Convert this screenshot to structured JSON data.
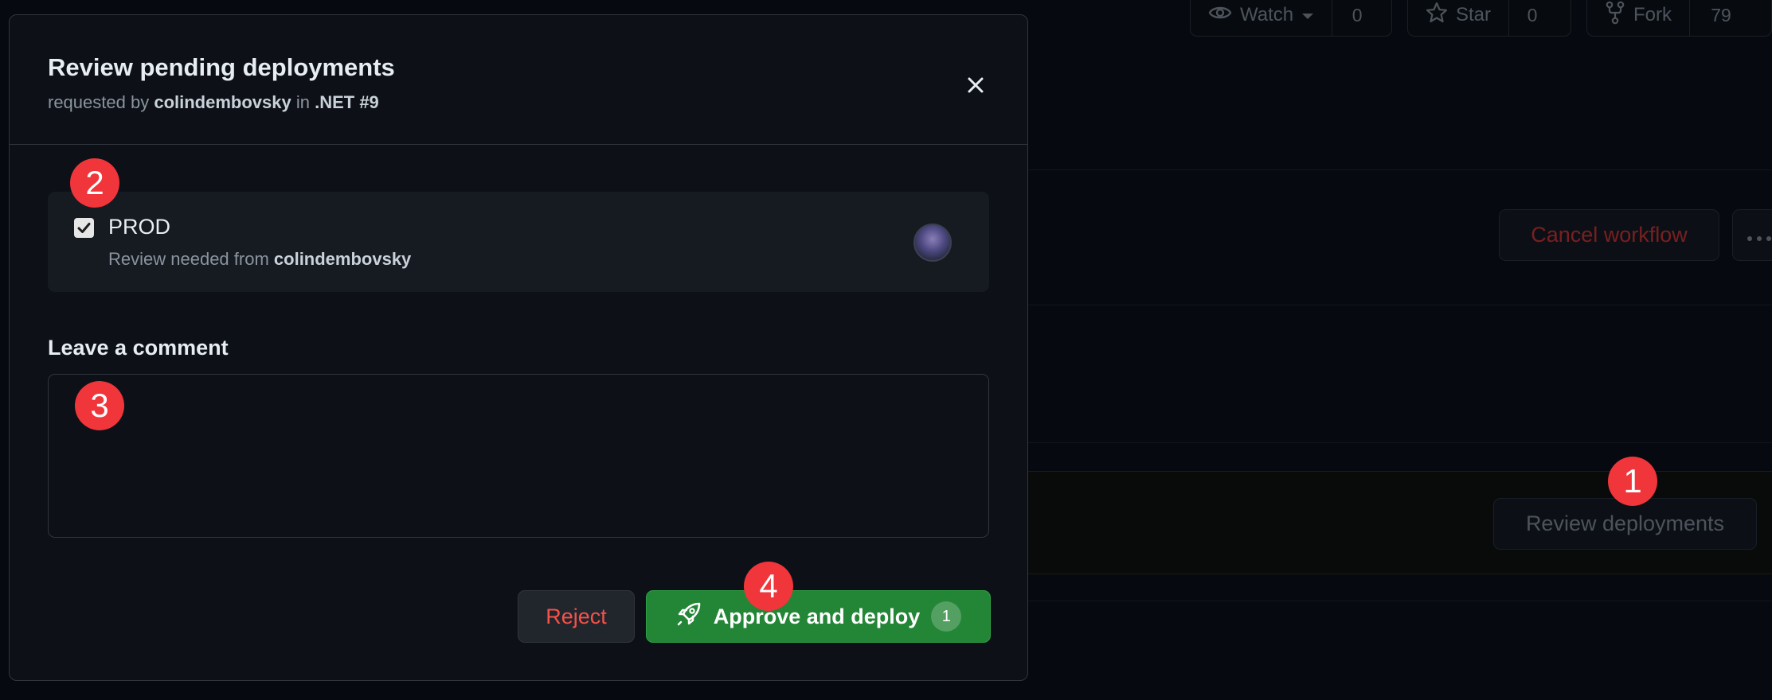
{
  "header": {
    "watch": {
      "label": "Watch",
      "count": "0"
    },
    "star": {
      "label": "Star",
      "count": "0"
    },
    "fork": {
      "label": "Fork",
      "count": "79"
    }
  },
  "background": {
    "cancel_workflow_label": "Cancel workflow",
    "review_deployments_label": "Review deployments"
  },
  "modal": {
    "title": "Review pending deployments",
    "subtitle": {
      "prefix": "requested by",
      "user": "colindembovsky",
      "in_word": "in",
      "run": ".NET #9"
    },
    "environment": {
      "name": "PROD",
      "checked": true,
      "review_prefix": "Review needed from",
      "reviewer": "colindembovsky"
    },
    "comment": {
      "label": "Leave a comment",
      "value": ""
    },
    "reject_label": "Reject",
    "approve_label": "Approve and deploy",
    "approve_count": "1"
  },
  "callouts": [
    "1",
    "2",
    "3",
    "4"
  ],
  "colors": {
    "background": "#0b0e14",
    "modal": "#0d1117",
    "approve": "#238636",
    "reject_text": "#f85149",
    "callout": "#f0353b"
  }
}
